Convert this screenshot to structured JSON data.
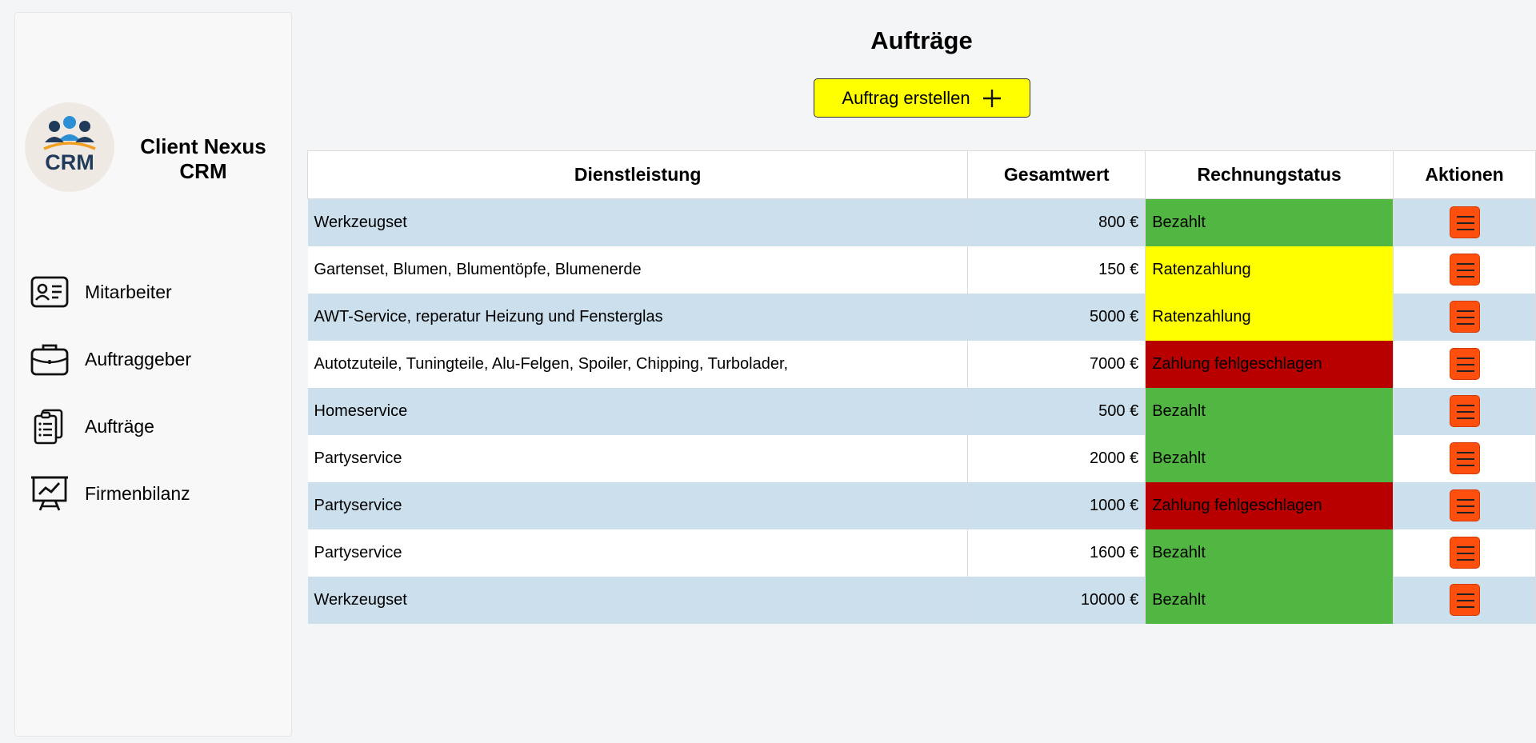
{
  "brand": {
    "name": "Client Nexus CRM",
    "logo_text": "CRM"
  },
  "nav": [
    {
      "label": "Mitarbeiter",
      "icon": "id-card-icon"
    },
    {
      "label": "Auftraggeber",
      "icon": "briefcase-icon"
    },
    {
      "label": "Aufträge",
      "icon": "clipboard-list-icon"
    },
    {
      "label": "Firmenbilanz",
      "icon": "presentation-chart-icon"
    }
  ],
  "page": {
    "title": "Aufträge",
    "create_label": "Auftrag erstellen"
  },
  "colors": {
    "create_button": "#ffff00",
    "paid": "#52b642",
    "installment": "#ffff00",
    "failed": "#b80000",
    "action_button": "#ff4f0f",
    "row_alt": "#cbe0ec"
  },
  "table": {
    "headers": [
      "Dienstleistung",
      "Gesamtwert",
      "Rechnungstatus",
      "Aktionen"
    ],
    "rows": [
      {
        "service": "Werkzeugset",
        "total": "800 €",
        "status": "Bezahlt",
        "status_type": "paid"
      },
      {
        "service": "Gartenset, Blumen, Blumentöpfe, Blumenerde",
        "total": "150 €",
        "status": "Ratenzahlung",
        "status_type": "rate"
      },
      {
        "service": "AWT-Service, reperatur Heizung und Fensterglas",
        "total": "5000 €",
        "status": "Ratenzahlung",
        "status_type": "rate"
      },
      {
        "service": "Autotzuteile, Tuningteile, Alu-Felgen, Spoiler, Chipping, Turbolader,",
        "total": "7000 €",
        "status": "Zahlung fehlgeschlagen",
        "status_type": "fail"
      },
      {
        "service": "Homeservice",
        "total": "500 €",
        "status": "Bezahlt",
        "status_type": "paid"
      },
      {
        "service": "Partyservice",
        "total": "2000 €",
        "status": "Bezahlt",
        "status_type": "paid"
      },
      {
        "service": "Partyservice",
        "total": "1000 €",
        "status": "Zahlung fehlgeschlagen",
        "status_type": "fail"
      },
      {
        "service": "Partyservice",
        "total": "1600 €",
        "status": "Bezahlt",
        "status_type": "paid"
      },
      {
        "service": "Werkzeugset",
        "total": "10000 €",
        "status": "Bezahlt",
        "status_type": "paid"
      }
    ]
  }
}
